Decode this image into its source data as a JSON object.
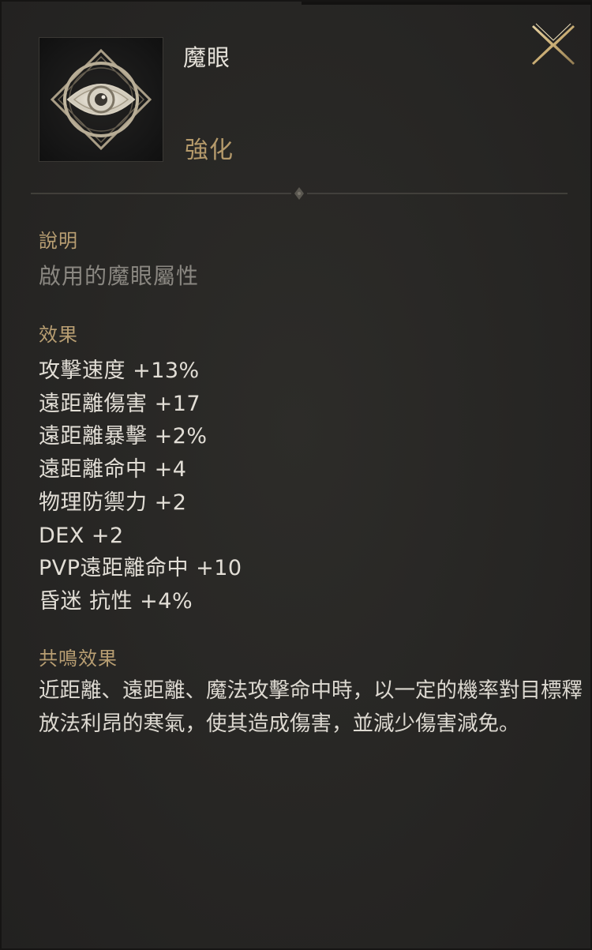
{
  "item": {
    "name": "魔眼",
    "category": "強化",
    "icon": "magic-eye-icon"
  },
  "description": {
    "label": "說明",
    "text": "啟用的魔眼屬性"
  },
  "effects": {
    "label": "效果",
    "lines": [
      "攻擊速度 +13%",
      "遠距離傷害 +17",
      "遠距離暴擊 +2%",
      "遠距離命中 +4",
      "物理防禦力 +2",
      "DEX +2",
      "PVP遠距離命中 +10",
      "昏迷 抗性 +4%"
    ]
  },
  "resonance": {
    "label": "共鳴效果",
    "text": "近距離、遠距離、魔法攻擊命中時，以一定的機率對目標釋放法利昂的寒氣，使其造成傷害，並減少傷害減免。"
  },
  "colors": {
    "accent_gold": "#b89e72",
    "text_primary": "#e2ded6",
    "text_muted": "#8a8781",
    "panel_bg": "#272624"
  }
}
